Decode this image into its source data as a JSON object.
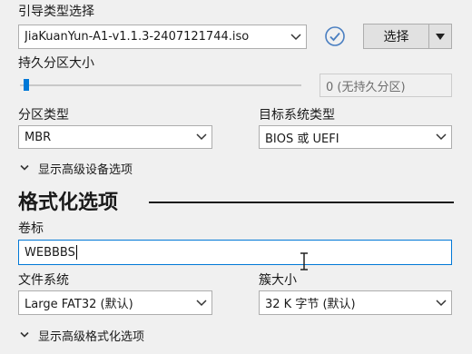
{
  "boot": {
    "label": "引导类型选择",
    "value": "JiaKuanYun-A1-v1.1.3-2407121744.iso",
    "select_button": "选择"
  },
  "persistence": {
    "label": "持久分区大小",
    "value": "0 (无持久分区)",
    "level": 0
  },
  "partition": {
    "label": "分区类型",
    "value": "MBR"
  },
  "target": {
    "label": "目标系统类型",
    "value": "BIOS 或 UEFI"
  },
  "advanced_device": {
    "label": "显示高级设备选项"
  },
  "format_section": {
    "title": "格式化选项"
  },
  "volume": {
    "label": "卷标",
    "value": "WEBBBS"
  },
  "filesystem": {
    "label": "文件系统",
    "value": "Large FAT32 (默认)"
  },
  "cluster": {
    "label": "簇大小",
    "value": "32 K 字节 (默认)"
  },
  "advanced_format": {
    "label": "显示高级格式化选项"
  },
  "colors": {
    "accent": "#0078d7",
    "check": "#4a7fc1"
  }
}
